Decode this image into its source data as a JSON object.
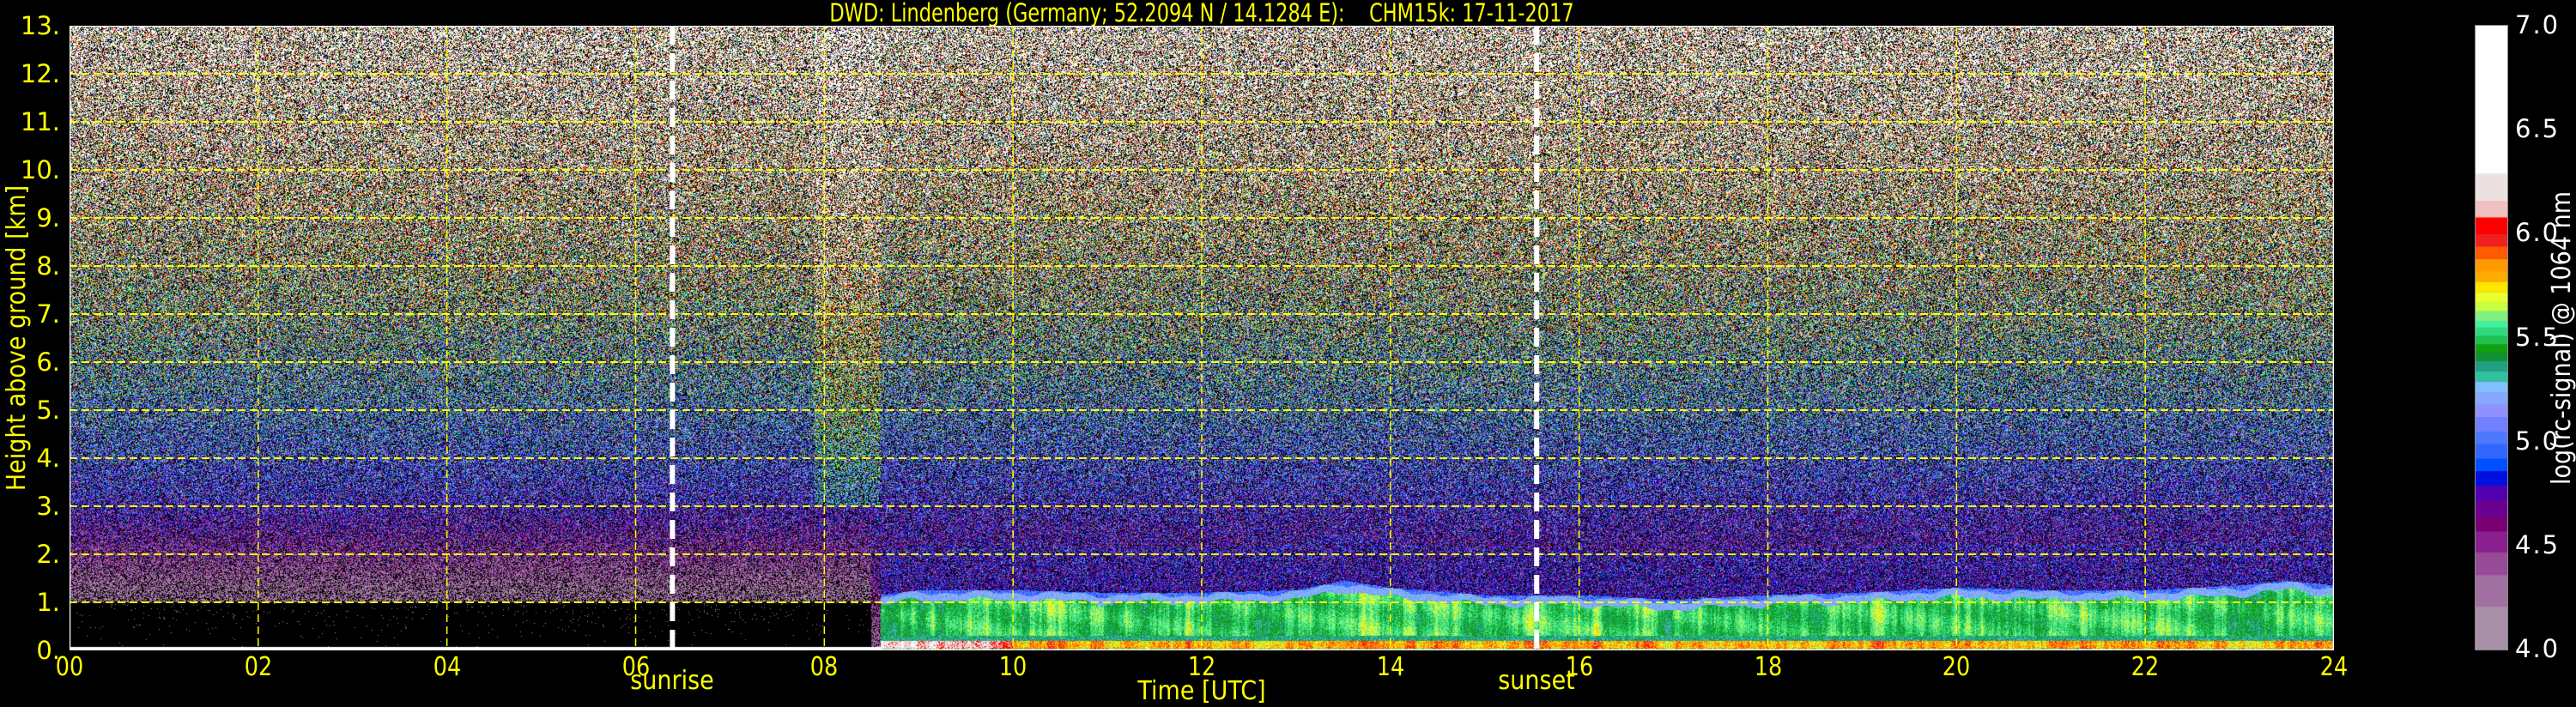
{
  "title": "DWD: Lindenberg (Germany; 52.2094 N / 14.1284 E):    CHM15k: 17-11-2017",
  "chart_data": {
    "type": "heatmap",
    "title": "DWD: Lindenberg (Germany; 52.2094 N / 14.1284 E):    CHM15k: 17-11-2017",
    "xlabel": "Time [UTC]",
    "ylabel": "Height above ground [km]",
    "xlim": [
      0,
      24
    ],
    "ylim": [
      0,
      13
    ],
    "x_ticks": [
      0,
      2,
      4,
      6,
      8,
      10,
      12,
      14,
      16,
      18,
      20,
      22,
      24
    ],
    "x_tick_labels": [
      "00",
      "02",
      "04",
      "06",
      "08",
      "10",
      "12",
      "14",
      "16",
      "18",
      "20",
      "22",
      "24"
    ],
    "y_ticks": [
      0,
      1,
      2,
      3,
      4,
      5,
      6,
      7,
      8,
      9,
      10,
      11,
      12,
      13
    ],
    "y_tick_labels": [
      "0.",
      "1.",
      "2.",
      "3.",
      "4.",
      "5.",
      "6.",
      "7.",
      "8.",
      "9.",
      "10.",
      "11.",
      "12.",
      "13."
    ],
    "grid": true,
    "grid_color": "#ffff00",
    "markers": [
      {
        "label": "sunrise",
        "time": 6.39,
        "color": "#ffffff"
      },
      {
        "label": "sunset",
        "time": 15.55,
        "color": "#ffffff"
      }
    ],
    "boundary_layer": {
      "times": [
        8.6,
        9,
        10,
        11,
        12,
        13,
        13.5,
        14,
        15,
        16,
        17,
        18,
        19,
        20,
        21,
        22,
        23,
        23.5,
        24
      ],
      "top_km": [
        1.1,
        1.2,
        1.2,
        1.15,
        1.15,
        1.2,
        1.4,
        1.25,
        1.1,
        1.1,
        1.0,
        1.1,
        1.15,
        1.25,
        1.2,
        1.2,
        1.3,
        1.4,
        1.3
      ]
    },
    "colorbar": {
      "label": "log(rc-signal) @ 1064 nm",
      "range": [
        4.0,
        7.0
      ],
      "ticks": [
        4.0,
        4.5,
        5.0,
        5.5,
        6.0,
        6.5,
        7.0
      ],
      "tick_labels": [
        "4.0",
        "4.5",
        "5.0",
        "5.5",
        "6.0",
        "6.5",
        "7.0"
      ],
      "levels": [
        4.0,
        4.21,
        4.36,
        4.47,
        4.57,
        4.64,
        4.72,
        4.79,
        4.86,
        4.92,
        4.99,
        5.05,
        5.12,
        5.18,
        5.24,
        5.29,
        5.34,
        5.39,
        5.43,
        5.47,
        5.51,
        5.55,
        5.58,
        5.63,
        5.67,
        5.72,
        5.77,
        5.82,
        5.88,
        5.94,
        6.0,
        6.08,
        6.16,
        6.29,
        7.0
      ],
      "colors": [
        "#a890a8",
        "#a070a0",
        "#984a98",
        "#8a2090",
        "#780070",
        "#6a0090",
        "#5000b0",
        "#0010e0",
        "#0050ff",
        "#3068ff",
        "#5078ff",
        "#7080ff",
        "#9090ff",
        "#88a8ff",
        "#80c0ff",
        "#30c0a0",
        "#20a080",
        "#109030",
        "#10a010",
        "#20c050",
        "#30d880",
        "#40f0a0",
        "#80f080",
        "#c8ff40",
        "#e8ff30",
        "#ffe600",
        "#ffaa00",
        "#ff9900",
        "#ff5a00",
        "#ee2020",
        "#ff0000",
        "#f0c0c0",
        "#ece0e0",
        "#ffffff"
      ]
    }
  }
}
